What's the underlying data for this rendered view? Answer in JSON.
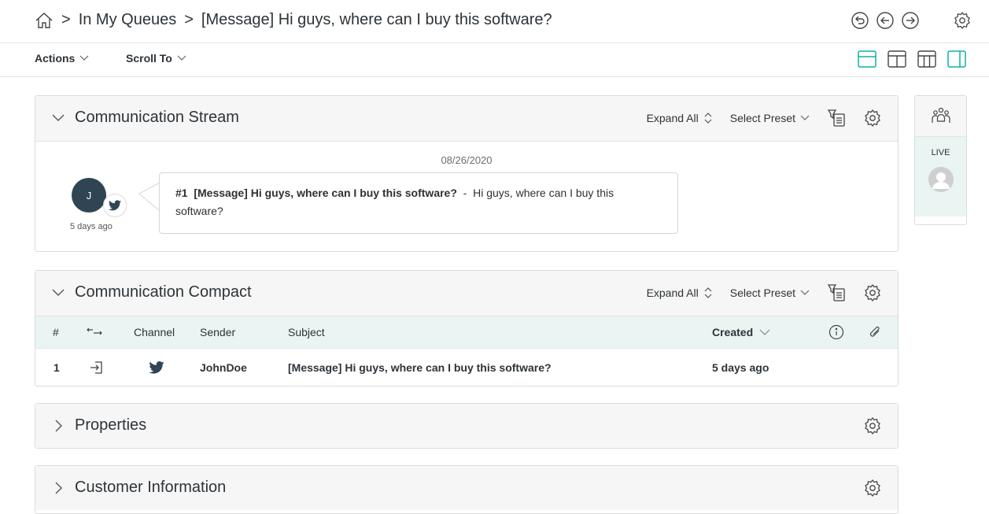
{
  "breadcrumb": {
    "home_icon": "home-icon",
    "items": [
      "In My Queues",
      "[Message] Hi guys, where can I buy this software?"
    ],
    "separator": ">"
  },
  "nav_icons": [
    "back-circle-icon",
    "arrow-left-circle-icon",
    "arrow-right-circle-icon",
    "gear-icon"
  ],
  "toolbar": {
    "actions_label": "Actions",
    "scroll_to_label": "Scroll To"
  },
  "layout_icons": [
    "layout-top-icon",
    "layout-columns-icon",
    "layout-three-columns-icon",
    "layout-sidebar-icon"
  ],
  "colors": {
    "accent": "#0bb4a3",
    "avatar": "#2f4554",
    "header_bg": "#f6f6f6",
    "table_header_bg": "#e9f4f3"
  },
  "communication_stream": {
    "title": "Communication Stream",
    "expand_all": "Expand All",
    "select_preset": "Select Preset",
    "date": "08/26/2020",
    "message": {
      "avatar_initial": "J",
      "channel_icon": "twitter-icon",
      "time_ago": "5 days ago",
      "number": "#1",
      "subject": "[Message] Hi guys, where can I buy this software?",
      "separator": "-",
      "body": "Hi guys, where can I buy this software?"
    }
  },
  "communication_compact": {
    "title": "Communication Compact",
    "expand_all": "Expand All",
    "select_preset": "Select Preset",
    "columns": {
      "number": "#",
      "channel": "Channel",
      "sender": "Sender",
      "subject": "Subject",
      "created": "Created"
    },
    "rows": [
      {
        "number": "1",
        "direction_icon": "incoming-icon",
        "channel_icon": "twitter-icon",
        "sender": "JohnDoe",
        "subject": "[Message] Hi guys, where can I buy this software?",
        "created": "5 days ago"
      }
    ]
  },
  "properties": {
    "title": "Properties"
  },
  "customer_information": {
    "title": "Customer Information"
  },
  "live_panel": {
    "icon": "users-icon",
    "label": "LIVE"
  }
}
